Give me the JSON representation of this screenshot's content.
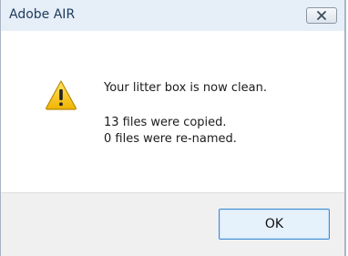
{
  "window": {
    "title": "Adobe AIR"
  },
  "dialog": {
    "icon": "warning-icon",
    "message": "Your litter box is now clean.",
    "details": [
      "13 files were copied.",
      "0 files were re-named."
    ]
  },
  "buttons": {
    "ok_label": "OK"
  },
  "colors": {
    "titlebar": "#e6eef7",
    "footer": "#f0f0f0",
    "ok_border": "#3c8bd4",
    "warning_yellow": "#f5c400"
  }
}
